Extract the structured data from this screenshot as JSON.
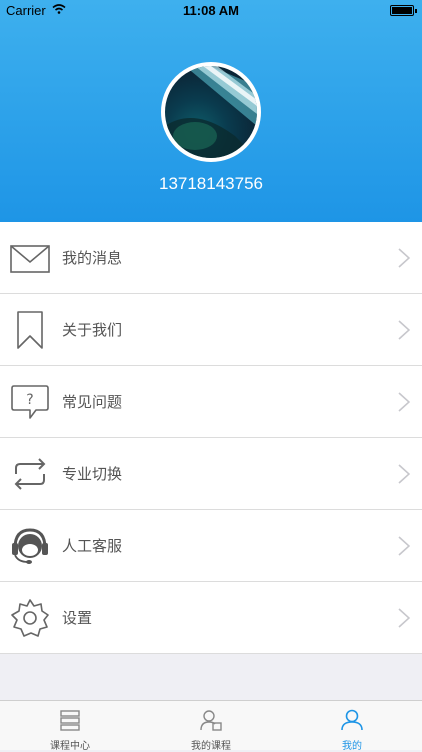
{
  "status_bar": {
    "carrier": "Carrier",
    "time": "11:08 AM"
  },
  "profile": {
    "phone": "13718143756"
  },
  "menu": {
    "items": [
      {
        "label": "我的消息",
        "icon": "mail-icon"
      },
      {
        "label": "关于我们",
        "icon": "bookmark-icon"
      },
      {
        "label": "常见问题",
        "icon": "question-bubble-icon"
      },
      {
        "label": "专业切换",
        "icon": "switch-arrows-icon"
      },
      {
        "label": "人工客服",
        "icon": "headset-icon"
      },
      {
        "label": "设置",
        "icon": "gear-icon"
      }
    ]
  },
  "tabbar": {
    "tabs": [
      {
        "label": "课程中心",
        "icon": "courses-icon",
        "active": false
      },
      {
        "label": "我的课程",
        "icon": "my-courses-icon",
        "active": false
      },
      {
        "label": "我的",
        "icon": "profile-icon",
        "active": true
      }
    ]
  },
  "colors": {
    "accent": "#1e95e6",
    "header_top": "#3eb0ee"
  }
}
